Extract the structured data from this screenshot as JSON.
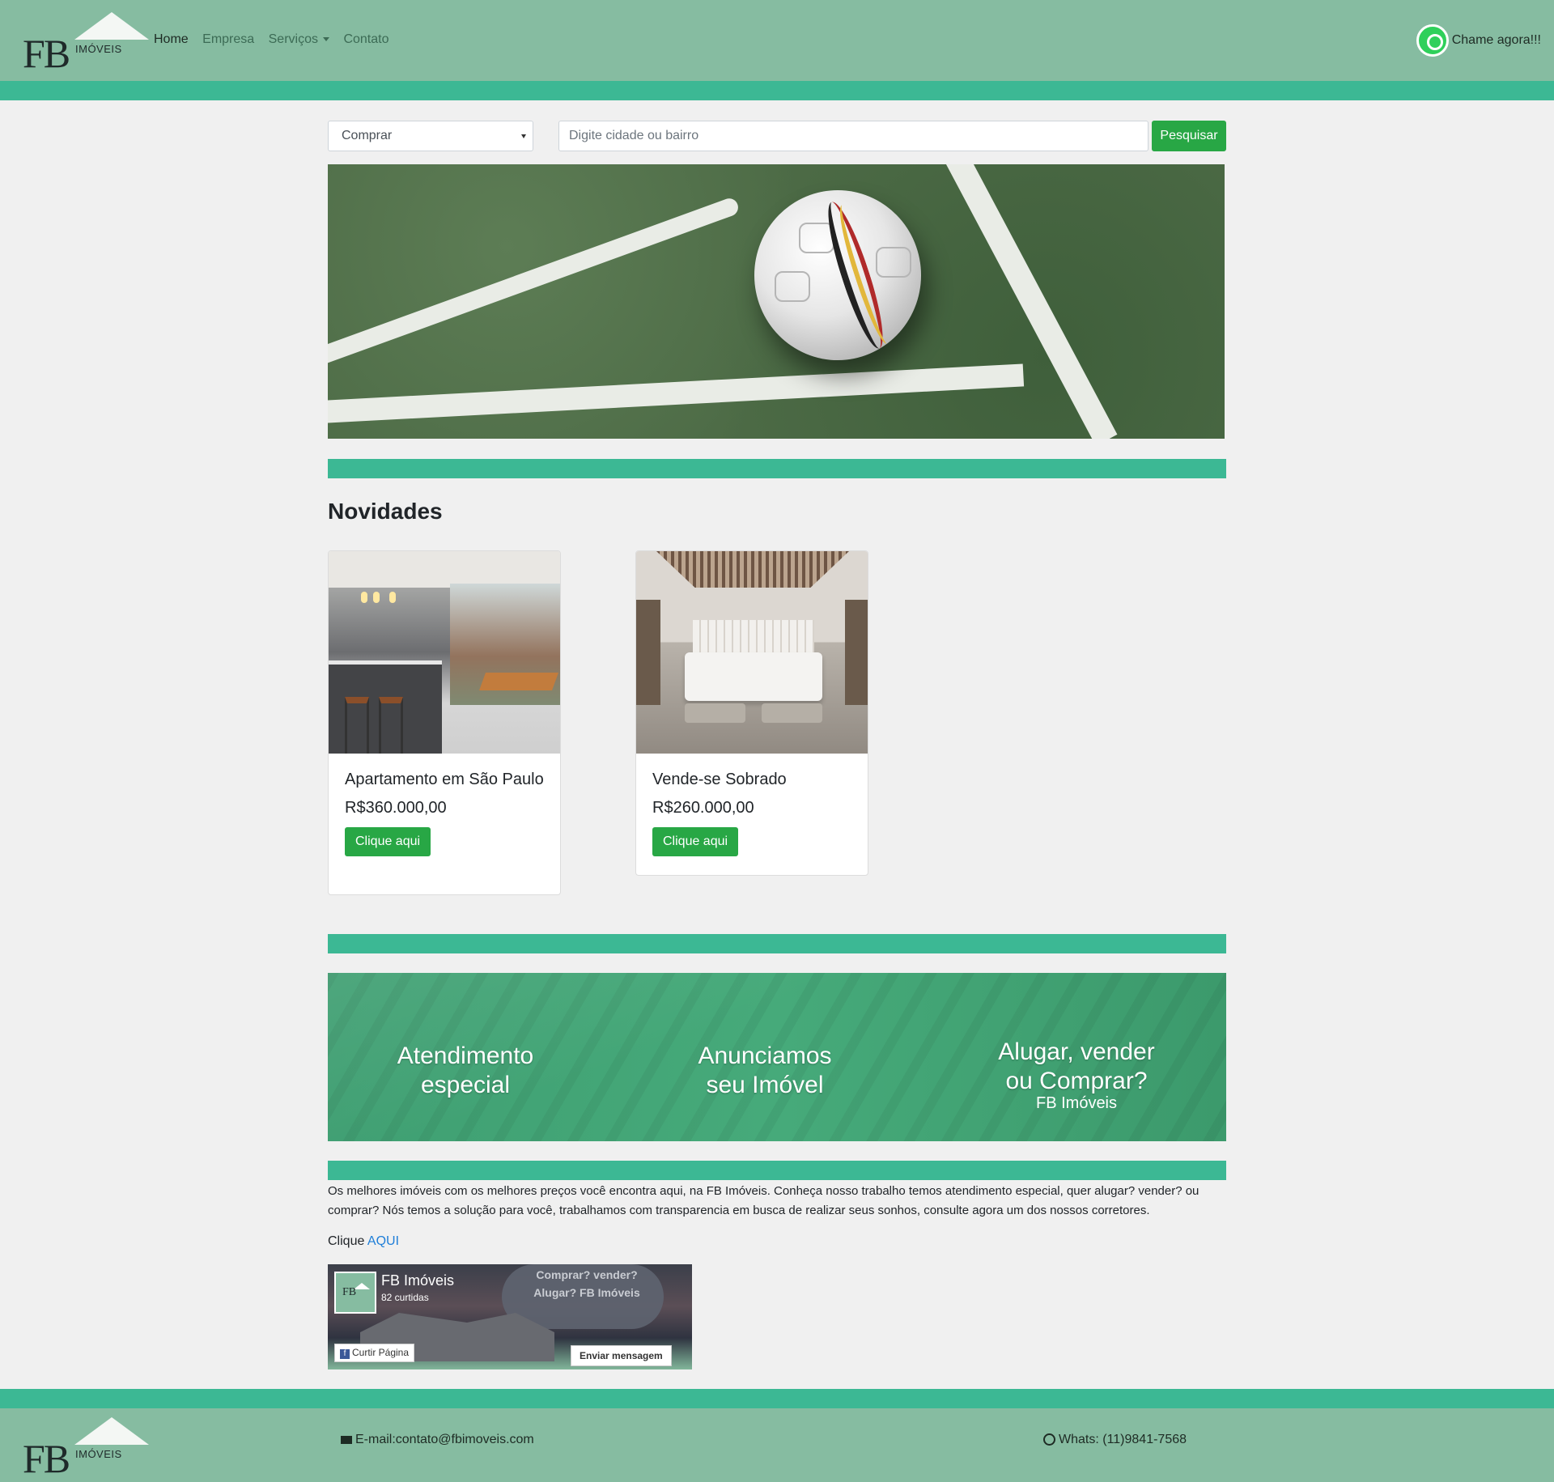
{
  "brand": {
    "logo_main": "FB",
    "logo_sub": "IMÓVEIS"
  },
  "nav": {
    "items": [
      {
        "label": "Home",
        "active": true
      },
      {
        "label": "Empresa"
      },
      {
        "label": "Serviços",
        "dropdown": true
      },
      {
        "label": "Contato"
      }
    ],
    "whatsapp_label": "Chame agora!!!"
  },
  "search": {
    "select_value": "Comprar",
    "placeholder": "Digite cidade ou bairro",
    "button": "Pesquisar"
  },
  "section": {
    "title": "Novidades"
  },
  "cards": [
    {
      "title": "Apartamento em São Paulo",
      "price": "R$360.000,00",
      "button": "Clique aqui"
    },
    {
      "title": "Vende-se Sobrado",
      "price": "R$260.000,00",
      "button": "Clique aqui"
    }
  ],
  "promo": {
    "col1": "Atendimento especial",
    "col2": "Anunciamos seu Imóvel",
    "col3": "Alugar, vender ou Comprar?",
    "col3_sub": "FB Imóveis"
  },
  "about": {
    "text": "Os melhores imóveis com os melhores preços você encontra aqui, na FB Imóveis. Conheça nosso trabalho temos atendimento especial, quer alugar? vender? ou comprar? Nós temos a solução para você, trabalhamos com transparencia em busca de realizar seus sonhos, consulte agora um dos nossos corretores.",
    "clique_prefix": "Clique",
    "clique_link": "AQUI"
  },
  "facebook": {
    "page_name": "FB Imóveis",
    "likes": "82 curtidas",
    "like_button": "Curtir Página",
    "message_button": "Enviar mensagem",
    "cover_text": "Comprar? vender? Alugar? FB Imóveis"
  },
  "footer": {
    "email": "E-mail:contato@fbimoveis.com",
    "whats": "Whats: (11)9841-7568"
  },
  "colors": {
    "header_bg": "#86bca1",
    "stripe": "#3cb894",
    "button_green": "#28a745",
    "link": "#1e7ed8"
  }
}
